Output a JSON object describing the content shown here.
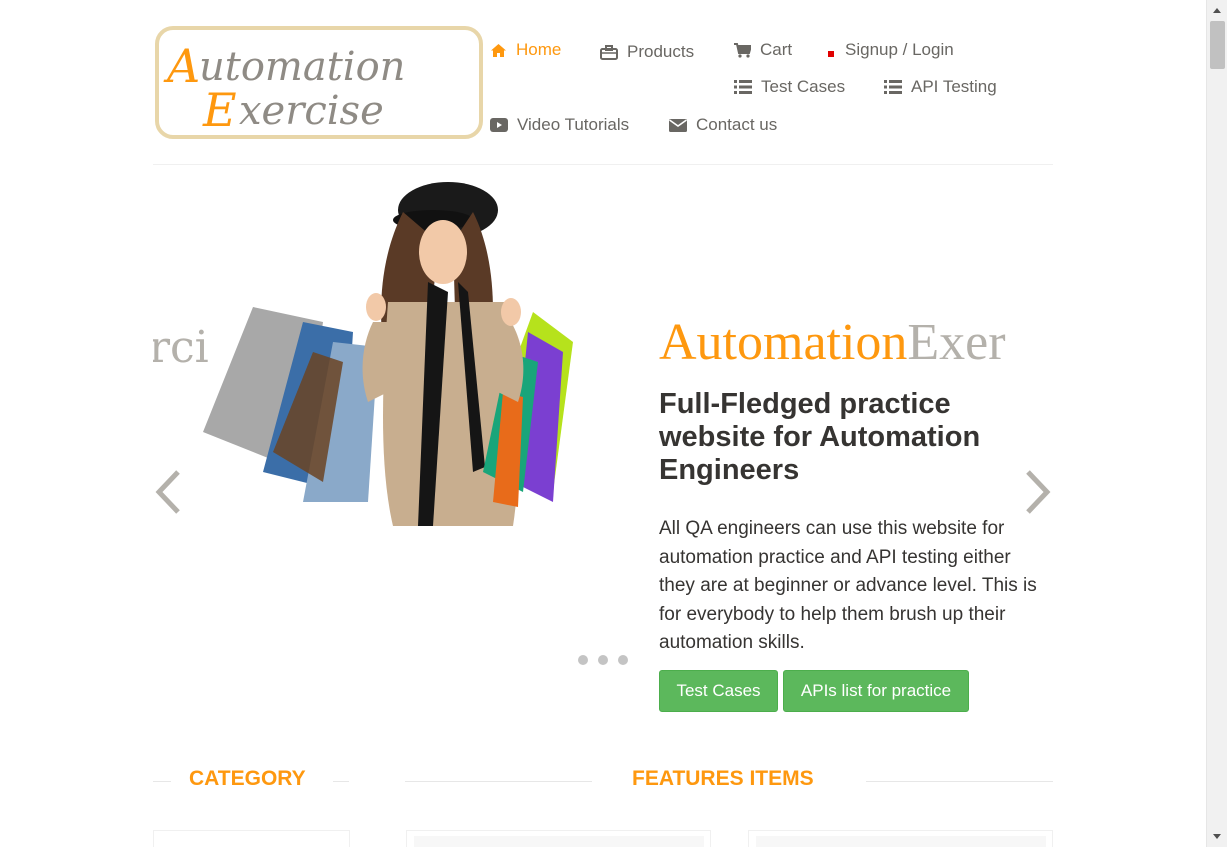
{
  "logo": {
    "line1": "Automation",
    "line2": "Exercise"
  },
  "nav": {
    "home": "Home",
    "products": "Products",
    "cart": "Cart",
    "signup_login": "Signup / Login",
    "test_cases": "Test Cases",
    "api_testing": "API Testing",
    "video_tutorials": "Video Tutorials",
    "contact_us": "Contact us",
    "icons": {
      "home": "home-icon",
      "products": "briefcase-icon",
      "cart": "cart-icon",
      "signup_login": "lock-icon",
      "test_cases": "list-icon",
      "api_testing": "list-icon",
      "video_tutorials": "youtube-play-icon",
      "contact_us": "envelope-icon"
    },
    "active_color": "#fe980f"
  },
  "slider": {
    "ghost_text": "rci",
    "brand_first": "Automation",
    "brand_second": "Exer",
    "heading": "Full-Fledged practice website for Automation Engineers",
    "text": "All QA engineers can use this website for automation practice and API testing either they are at beginner or advance level. This is for everybody to help them brush up their automation skills.",
    "btn_test_cases": "Test Cases",
    "btn_apis": "APIs list for practice",
    "dots_count": 3,
    "button_color": "#5cb85c"
  },
  "sections": {
    "category": "CATEGORY",
    "features": "FEATURES ITEMS"
  },
  "colors": {
    "accent": "#fe980f",
    "text": "#696763",
    "dark": "#363432"
  }
}
